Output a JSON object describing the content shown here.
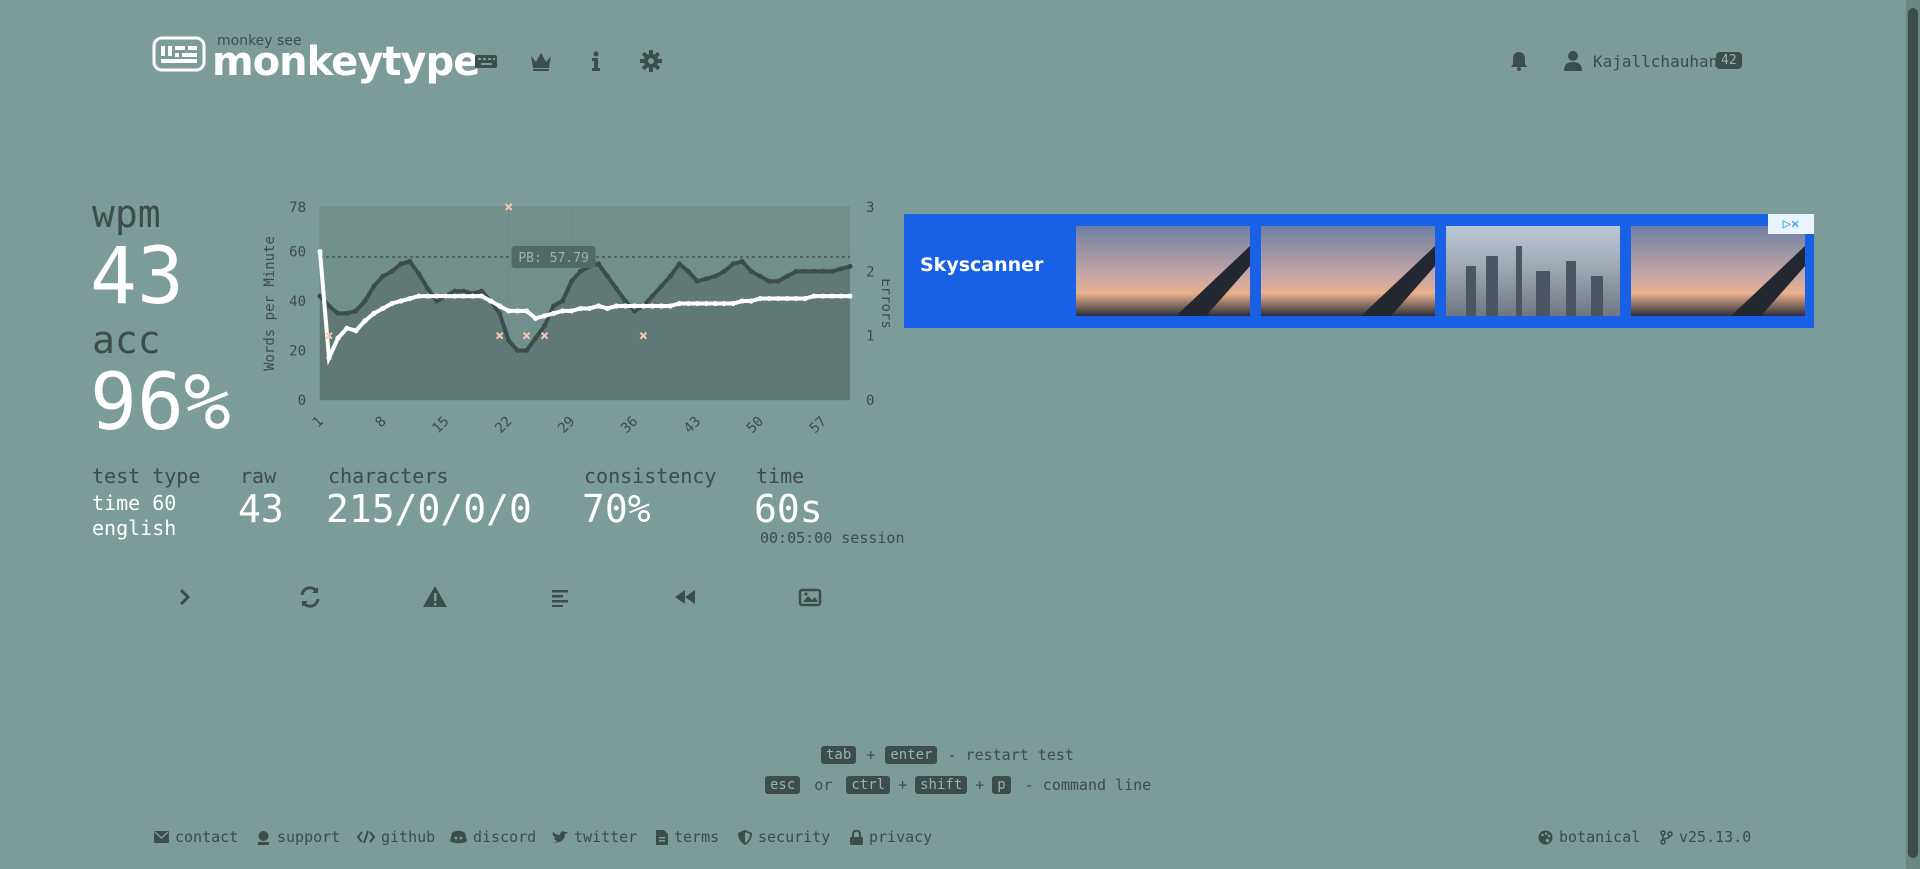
{
  "header": {
    "logo_subtitle": "monkey see",
    "logo_text": "monkeytype",
    "nav_icons": [
      "keyboard-icon",
      "crown-icon",
      "info-icon",
      "gear-icon"
    ],
    "user_name": "Kajallchauhan",
    "user_level": "42"
  },
  "stats": {
    "wpm_label": "wpm",
    "wpm_value": "43",
    "acc_label": "acc",
    "acc_value": "96%",
    "test_type_label": "test type",
    "test_type_line1": "time 60",
    "test_type_line2": "english",
    "raw_label": "raw",
    "raw_value": "43",
    "characters_label": "characters",
    "characters_value": "215/0/0/0",
    "consistency_label": "consistency",
    "consistency_value": "70%",
    "time_label": "time",
    "time_value": "60s",
    "session_text": "00:05:00 session"
  },
  "chart_data": {
    "type": "line",
    "ylabel": "Words per Minute",
    "y2label": "Errors",
    "ylim": [
      0,
      78
    ],
    "y2lim": [
      0,
      3
    ],
    "yticks": [
      "0",
      "20",
      "40",
      "60",
      "78"
    ],
    "y2ticks": [
      "0",
      "1",
      "2",
      "3"
    ],
    "xticks": [
      "1",
      "8",
      "15",
      "22",
      "29",
      "36",
      "43",
      "50",
      "57"
    ],
    "pb_label": "PB: 57.79",
    "pb_value": 57.79,
    "x": [
      1,
      2,
      3,
      4,
      5,
      6,
      7,
      8,
      9,
      10,
      11,
      12,
      13,
      14,
      15,
      16,
      17,
      18,
      19,
      20,
      21,
      22,
      23,
      24,
      25,
      26,
      27,
      28,
      29,
      30,
      31,
      32,
      33,
      34,
      35,
      36,
      37,
      38,
      39,
      40,
      41,
      42,
      43,
      44,
      45,
      46,
      47,
      48,
      49,
      50,
      51,
      52,
      53,
      54,
      55,
      56,
      57,
      58,
      59,
      60
    ],
    "series": [
      {
        "name": "wpm",
        "values": [
          60,
          17,
          25,
          29,
          28,
          32,
          35,
          37,
          39,
          40,
          41,
          42,
          42,
          42,
          42,
          42,
          42,
          42,
          42,
          40,
          38,
          36,
          36,
          36,
          33,
          34,
          35,
          36,
          36,
          37,
          37,
          38,
          37,
          38,
          38,
          38,
          38,
          38,
          38,
          38,
          39,
          39,
          39,
          39,
          39,
          39,
          39,
          40,
          40,
          41,
          41,
          41,
          41,
          41,
          41,
          42,
          42,
          42,
          42,
          42
        ]
      },
      {
        "name": "raw",
        "values": [
          42,
          38,
          35,
          35,
          36,
          40,
          46,
          50,
          52,
          55,
          56,
          51,
          45,
          40,
          42,
          44,
          44,
          43,
          44,
          40,
          35,
          24,
          20,
          20,
          25,
          30,
          38,
          40,
          48,
          52,
          54,
          55,
          50,
          45,
          40,
          36,
          38,
          42,
          46,
          50,
          55,
          52,
          48,
          49,
          50,
          52,
          55,
          56,
          52,
          50,
          48,
          48,
          50,
          52,
          52,
          52,
          52,
          52,
          53,
          54
        ]
      }
    ],
    "errors": [
      {
        "x": 2,
        "y": 1
      },
      {
        "x": 21,
        "y": 1
      },
      {
        "x": 22,
        "y": 3
      },
      {
        "x": 24,
        "y": 1
      },
      {
        "x": 26,
        "y": 1
      },
      {
        "x": 37,
        "y": 1
      }
    ]
  },
  "ad": {
    "brand": "Skyscanner",
    "badge": "▷✕"
  },
  "actions": [
    "next-test",
    "restart-test",
    "report-issue",
    "words-history",
    "replay",
    "save-screenshot"
  ],
  "shortcuts": {
    "line1": {
      "k1": "tab",
      "plus": "+",
      "k2": "enter",
      "text": "- restart test"
    },
    "line2": {
      "k1": "esc",
      "or": "or",
      "k2": "ctrl",
      "plus1": "+",
      "k3": "shift",
      "plus2": "+",
      "k4": "p",
      "text": "- command line"
    }
  },
  "footer": {
    "contact": "contact",
    "support": "support",
    "github": "github",
    "discord": "discord",
    "twitter": "twitter",
    "terms": "terms",
    "security": "security",
    "privacy": "privacy",
    "theme": "botanical",
    "version": "v25.13.0"
  },
  "colors": {
    "background": "#7b9c98",
    "sub": "#3d4d4b",
    "text": "#ffffff",
    "error": "#f6c9b4",
    "ad_blue": "#1861e7"
  }
}
